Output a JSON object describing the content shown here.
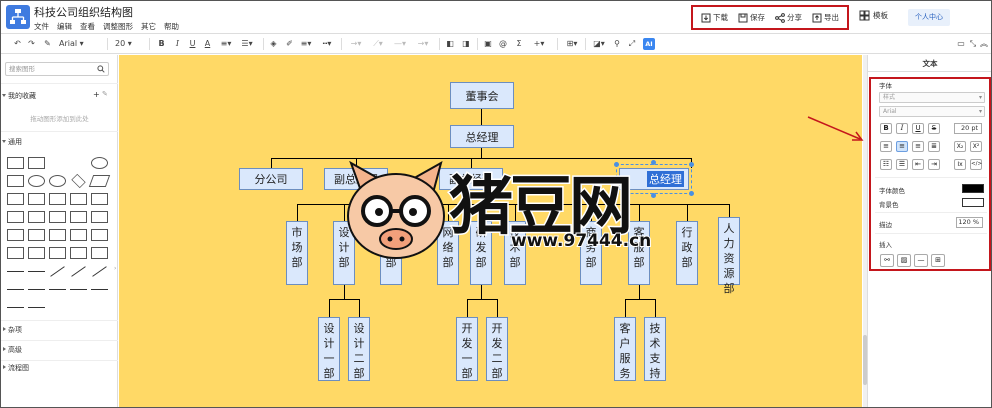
{
  "app": {
    "title": "科技公司组织结构图",
    "menu": [
      "文件",
      "编辑",
      "查看",
      "调整图形",
      "其它",
      "帮助"
    ]
  },
  "top_actions": {
    "download": "下载",
    "save": "保存",
    "share": "分享",
    "export": "导出",
    "templates": "模板",
    "personal": "个人中心"
  },
  "toolbar": {
    "font_family": "Arial",
    "font_size": "20"
  },
  "sidebar": {
    "search_placeholder": "搜索图形",
    "favorites_label": "我的收藏",
    "favorites_hint": "拖动图形添加到此处",
    "general_label": "通用",
    "sections": [
      "杂项",
      "高级",
      "流程图"
    ]
  },
  "chart": {
    "board": "董事会",
    "gm": "总经理",
    "level2": [
      "分公司",
      "副总经理",
      "副总经理",
      "总经理"
    ],
    "departments": [
      "市场部",
      "设计部",
      "财务部",
      "网络部",
      "研发部",
      "技术部",
      "商务部",
      "客服部",
      "行政部",
      "人力资源部"
    ],
    "sub_departments": [
      "设计一部",
      "设计二部",
      "开发一部",
      "开发二部",
      "客户服务",
      "技术支持"
    ]
  },
  "right_panel": {
    "title": "文本",
    "font_label": "字体",
    "style_placeholder": "样式",
    "font_value": "Arial",
    "size_value": "20 pt",
    "font_color_label": "字体颜色",
    "bg_color_label": "背景色",
    "spacing_label": "描边",
    "spacing_value": "120 %",
    "insert_label": "插入",
    "font_color": "#000000",
    "bg_color": "#ffffff"
  },
  "watermark": {
    "title": "猪豆网",
    "url": "www.97444.cn"
  },
  "colors": {
    "canvas_bg": "#ffd966",
    "node_fill": "#dae8fc",
    "node_border": "#6c8ebf",
    "highlight_red": "#c4161c"
  }
}
